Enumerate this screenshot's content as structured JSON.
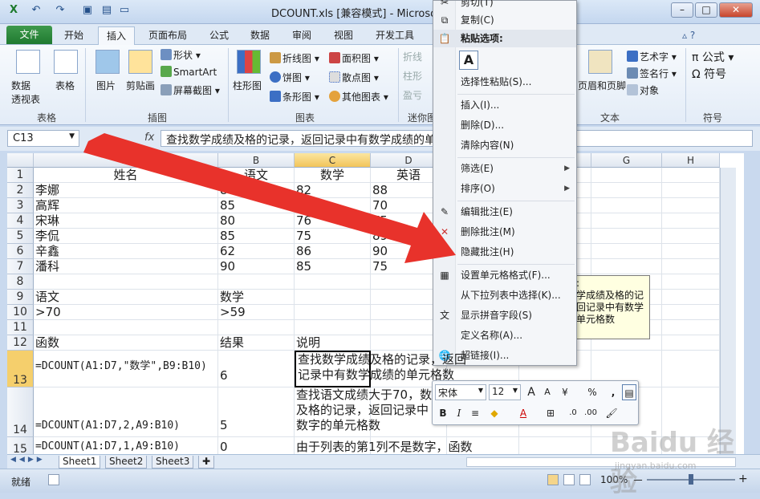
{
  "titlebar": {
    "title": "DCOUNT.xls  [兼容模式] - Microsoft Excel",
    "min": "–",
    "max": "□",
    "close": "✕"
  },
  "tabs": [
    "文件",
    "开始",
    "插入",
    "页面布局",
    "公式",
    "数据",
    "审阅",
    "视图",
    "开发工具"
  ],
  "ribbon": {
    "pivot": "数据\n透视表",
    "pivot_line1": "数据",
    "pivot_line2": "透视表",
    "table": "表格",
    "picture": "图片",
    "clipart": "剪贴画",
    "shapes": "形状",
    "smartart": "SmartArt",
    "screenshot": "屏幕截图",
    "column": "柱形图",
    "line": "折线图",
    "pie": "饼图",
    "bar": "条形图",
    "area": "面积图",
    "scatter": "散点图",
    "other": "其他图表",
    "spark_line": "折线",
    "spark_col": "柱形",
    "spark_wl": "盈亏",
    "header_footer": "页眉和页脚",
    "wordart": "艺术字",
    "signature": "签名行",
    "object": "对象",
    "formula": "公式",
    "symbol": "符号",
    "groups": {
      "tables": "表格",
      "illustrations": "插图",
      "charts": "图表",
      "sparklines": "迷你图",
      "text": "文本",
      "symbols": "符号"
    }
  },
  "formula_bar": {
    "name_box": "C13",
    "fx": "fx",
    "formula": "查找数学成绩及格的记录，返回记录中有数学成绩的单元格数"
  },
  "columns": [
    "A",
    "B",
    "C",
    "D",
    "E",
    "F",
    "G",
    "H"
  ],
  "rows": [
    {
      "n": "1",
      "a": "姓名",
      "b": "语文",
      "c": "数学",
      "d": "英语"
    },
    {
      "n": "2",
      "a": "李娜",
      "b": "80",
      "c": "82",
      "d": "88"
    },
    {
      "n": "3",
      "a": "高辉",
      "b": "85",
      "c": "72",
      "d": "70"
    },
    {
      "n": "4",
      "a": "宋琳",
      "b": "80",
      "c": "76",
      "d": "75"
    },
    {
      "n": "5",
      "a": "李侃",
      "b": "85",
      "c": "75",
      "d": "89"
    },
    {
      "n": "6",
      "a": "辛鑫",
      "b": "62",
      "c": "86",
      "d": "90"
    },
    {
      "n": "7",
      "a": "潘科",
      "b": "90",
      "c": "85",
      "d": "75"
    },
    {
      "n": "8",
      "a": "",
      "b": "",
      "c": "",
      "d": ""
    },
    {
      "n": "9",
      "a": "语文",
      "b": "数学",
      "c": "",
      "d": ""
    },
    {
      "n": "10",
      "a": ">70",
      "b": ">59",
      "c": "",
      "d": ""
    },
    {
      "n": "11",
      "a": "",
      "b": "",
      "c": "",
      "d": ""
    },
    {
      "n": "12",
      "a": "函数",
      "b": "结果",
      "c": "说明",
      "d": ""
    },
    {
      "n": "13",
      "a": "=DCOUNT(A1:D7,\"数学\",B9:B10)",
      "b": "6",
      "c": "查找数学成绩及格的记录，返回",
      "c2": "记录中有数学成绩的单元格数"
    },
    {
      "n": "14",
      "a": "=DCOUNT(A1:D7,2,A9:B10)",
      "b": "5",
      "c": "查找语文成绩大于70，数学",
      "c2": "及格的记录，返回记录中",
      "c3": "数字的单元格数"
    },
    {
      "n": "15",
      "a": "=DCOUNT(A1:D7,1,A9:B10)",
      "b": "0",
      "c": "由于列表的第1列不是数字，函数"
    }
  ],
  "sheets": [
    "Sheet1",
    "Sheet2",
    "Sheet3"
  ],
  "status": {
    "ready": "就绪",
    "zoom": "100%",
    "minus": "－",
    "plus": "+"
  },
  "context_menu": {
    "cut": "剪切(T)",
    "copy": "复制(C)",
    "paste_options": "粘贴选项:",
    "paste_a": "A",
    "paste_special": "选择性粘贴(S)...",
    "insert": "插入(I)...",
    "delete": "删除(D)...",
    "clear": "清除内容(N)",
    "filter": "筛选(E)",
    "sort": "排序(O)",
    "edit_comment": "编辑批注(E)",
    "delete_comment": "删除批注(M)",
    "hide_comment": "隐藏批注(H)",
    "format_cells": "设置单元格格式(F)...",
    "pick_list": "从下拉列表中选择(K)...",
    "phonetic": "显示拼音字段(S)",
    "define_name": "定义名称(A)...",
    "hyperlink": "超链接(I)..."
  },
  "comment": {
    "lines": [
      ":",
      "学成绩及格的记",
      "回记录中有数学",
      "单元格数"
    ]
  },
  "mini_toolbar": {
    "font": "宋体",
    "size": "12",
    "grow": "A",
    "shrink": "A",
    "percent": "%",
    "comma": ",",
    "bold": "B",
    "italic": "I",
    "font_color": "A"
  },
  "watermark": {
    "text": "Baidu 经验",
    "url": "jingyan.baidu.com"
  },
  "colors": {
    "accent_arrow": "#e8322b",
    "file_tab": "#1f7a30",
    "selection": "#f5cf6c"
  }
}
